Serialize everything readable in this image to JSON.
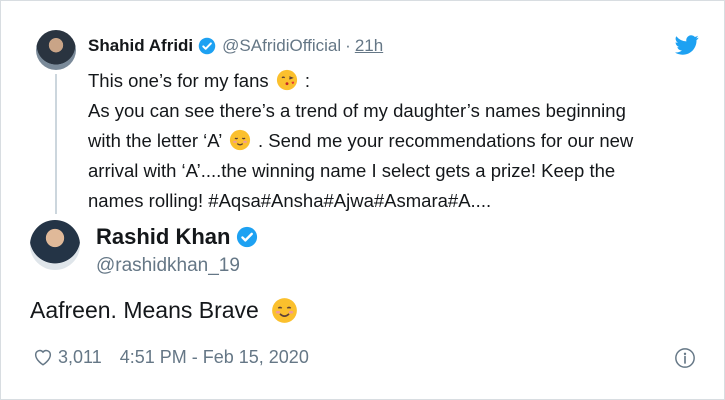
{
  "parent_tweet": {
    "author_name": "Shahid Afridi",
    "handle": "@SAfridiOfficial",
    "separator": "·",
    "time": "21h",
    "lines": [
      "This one’s for my fans",
      "As you can see there’s a trend of my daughter’s names beginning",
      "with the letter ‘A’",
      "arrival with ‘A’....the winning name I select gets a prize! Keep the",
      "names rolling! #Aqsa#Ansha#Ajwa#Asmara#A...."
    ],
    "line1_suffix": ":",
    "line3_suffix": ". Send me your recommendations for our new"
  },
  "reply_tweet": {
    "author_name": "Rashid Khan",
    "handle": "@rashidkhan_19",
    "text": "Aafreen. Means Brave",
    "likes": "3,011",
    "timestamp": "4:51 PM - Feb 15, 2020"
  },
  "colors": {
    "verified_blue": "#1da1f2",
    "secondary_text": "#657786",
    "primary_text": "#14171a"
  },
  "icons": [
    "twitter-bird-icon",
    "verified-badge-icon",
    "heart-icon",
    "info-icon",
    "kiss-emoji-icon",
    "blush-emoji-icon",
    "smile-emoji-icon"
  ]
}
